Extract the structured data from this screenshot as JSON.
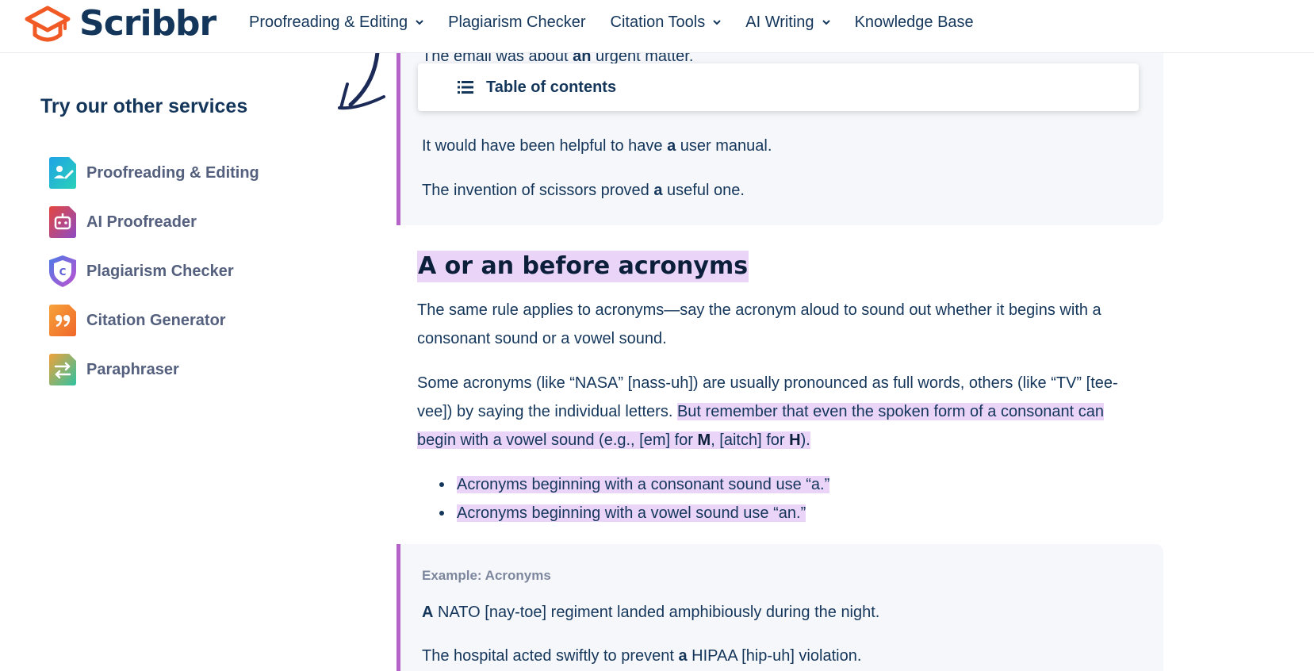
{
  "header": {
    "logo_text": "Scribbr",
    "nav": [
      {
        "label": "Proofreading & Editing",
        "dropdown": true
      },
      {
        "label": "Plagiarism Checker",
        "dropdown": false
      },
      {
        "label": "Citation Tools",
        "dropdown": true
      },
      {
        "label": "AI Writing",
        "dropdown": true
      },
      {
        "label": "Knowledge Base",
        "dropdown": false
      }
    ]
  },
  "sidebar": {
    "title": "Try our other services",
    "services": [
      {
        "label": "Proofreading & Editing",
        "icon": "proofreading-icon",
        "color": "#1fb7d6"
      },
      {
        "label": "AI Proofreader",
        "icon": "robot-icon",
        "color": "#c8466d"
      },
      {
        "label": "Plagiarism Checker",
        "icon": "shield-c-icon",
        "color": "#6b73e0"
      },
      {
        "label": "Citation Generator",
        "icon": "quote-icon",
        "color": "#f48b2a"
      },
      {
        "label": "Paraphraser",
        "icon": "arrows-swap-icon",
        "color": "#38b99a"
      }
    ]
  },
  "toc": {
    "label": "Table of contents"
  },
  "example_top": {
    "line1": {
      "before": "The email was about ",
      "bold": "an",
      "after": " urgent matter."
    },
    "line2": {
      "before": "It would have been helpful to have ",
      "bold": "a",
      "after": " user manual."
    },
    "line3": {
      "before": "The invention of scissors proved ",
      "bold": "a",
      "after": " useful one."
    }
  },
  "section": {
    "heading": "A or an before acronyms",
    "para1": "The same rule applies to acronyms—say the acronym aloud to sound out whether it begins with a consonant sound or a vowel sound.",
    "para2_plain": "Some acronyms (like “NASA” [nass-uh]) are usually pronounced as full words, others (like “TV” [tee-vee]) by saying the individual letters. ",
    "para2_hl_1": "But remember that even the spoken form of a consonant can begin with a vowel sound (e.g., [em] for ",
    "para2_bold_m": "M",
    "para2_hl_2": ", [aitch] for ",
    "para2_bold_h": "H",
    "para2_hl_3": ").",
    "bullets": [
      "Acronyms beginning with a consonant sound use “a.”",
      "Acronyms beginning with a vowel sound use “an.”"
    ]
  },
  "example_bottom": {
    "title": "Example: Acronyms",
    "line1": {
      "bold": "A",
      "after": " NATO [nay-toe] regiment landed amphibiously during the night."
    },
    "line2": {
      "before": "The hospital acted swiftly to prevent ",
      "bold": "a",
      "after": " HIPAA [hip-uh] violation."
    }
  },
  "colors": {
    "accent": "#b663c9",
    "highlight": "#ead5f8",
    "brand_orange": "#f15a24",
    "text": "#14365b"
  }
}
